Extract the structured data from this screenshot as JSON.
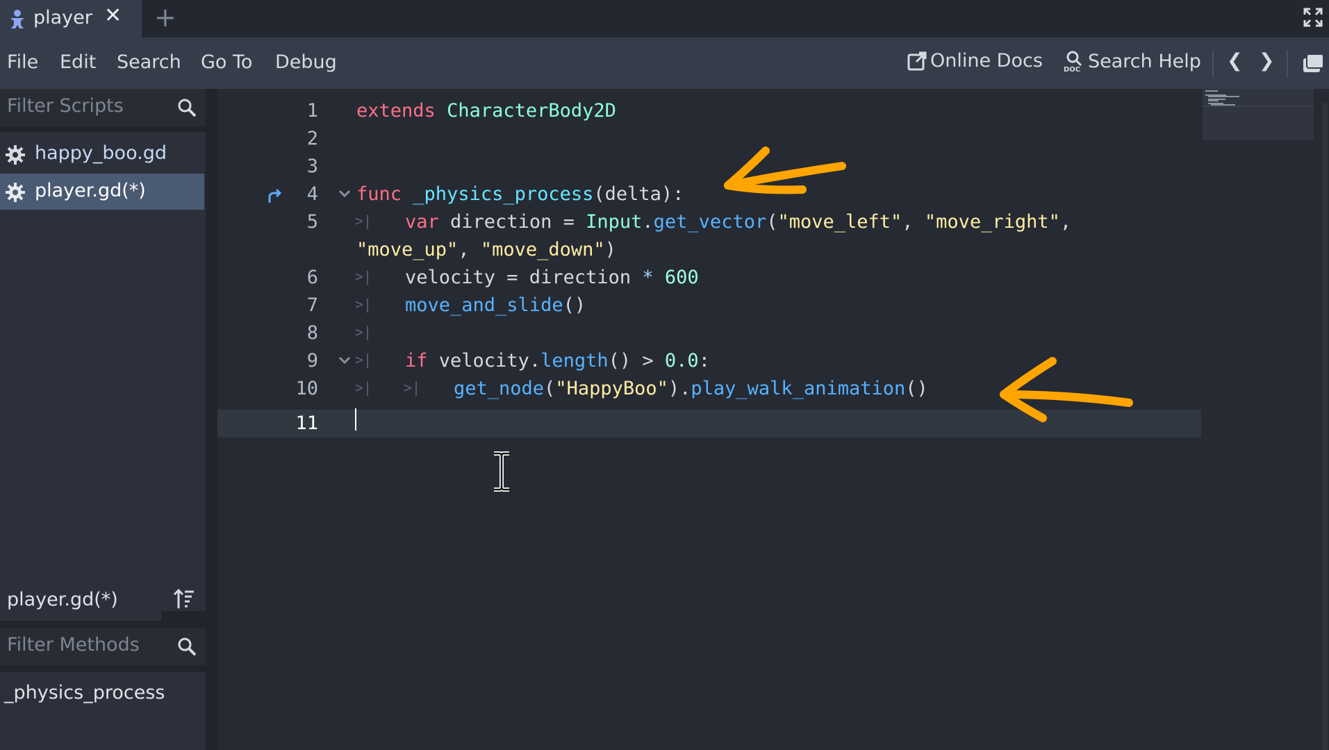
{
  "tab": {
    "label": "player",
    "close": "✕",
    "add": "+"
  },
  "menu": [
    "File",
    "Edit",
    "Search",
    "Go To",
    "Debug"
  ],
  "toolbar": {
    "online_docs": "Online Docs",
    "search_help": "Search Help",
    "back": "❮",
    "forward": "❯"
  },
  "scripts": {
    "filter_placeholder": "Filter Scripts",
    "items": [
      {
        "label": "happy_boo.gd",
        "selected": false
      },
      {
        "label": "player.gd(*)",
        "selected": true
      }
    ]
  },
  "current_script": "player.gd(*)",
  "methods": {
    "filter_placeholder": "Filter Methods",
    "items": [
      "_physics_process"
    ]
  },
  "code": {
    "line_numbers": [
      "1",
      "2",
      "3",
      "4",
      "5",
      "6",
      "7",
      "8",
      "9",
      "10",
      "11"
    ],
    "line1": {
      "kw": "extends",
      "cls": "CharacterBody2D"
    },
    "line4": {
      "kw": "func",
      "fname": "_physics_process",
      "rest": "(delta):"
    },
    "line5": {
      "kw": "var",
      "a": " direction = ",
      "cls": "Input",
      "dot": ".",
      "fn": "get_vector",
      "p1": "(",
      "s1": "\"move_left\"",
      "c1": ", ",
      "s2": "\"move_right\"",
      "c2": ","
    },
    "line5b": {
      "s3": "\"move_up\"",
      "c3": ", ",
      "s4": "\"move_down\"",
      "p2": ")"
    },
    "line6": {
      "a": "velocity = direction ",
      "op": "*",
      "b": " ",
      "num": "600"
    },
    "line7": {
      "fn": "move_and_slide",
      "p": "()"
    },
    "line9": {
      "kw": "if",
      "a": " velocity.",
      "fn": "length",
      "b": "() > ",
      "num": "0.0",
      "c": ":"
    },
    "line10": {
      "fn": "get_node",
      "p1": "(",
      "str": "\"HappyBoo\"",
      "p2": ").",
      "fn2": "play_walk_animation",
      "p3": "()"
    }
  },
  "colors": {
    "keyword": "#ff7085",
    "class": "#8effda",
    "function": "#57b3ff",
    "string": "#ffeda1",
    "number": "#a1ffe0",
    "annotation": "#ffa500"
  }
}
